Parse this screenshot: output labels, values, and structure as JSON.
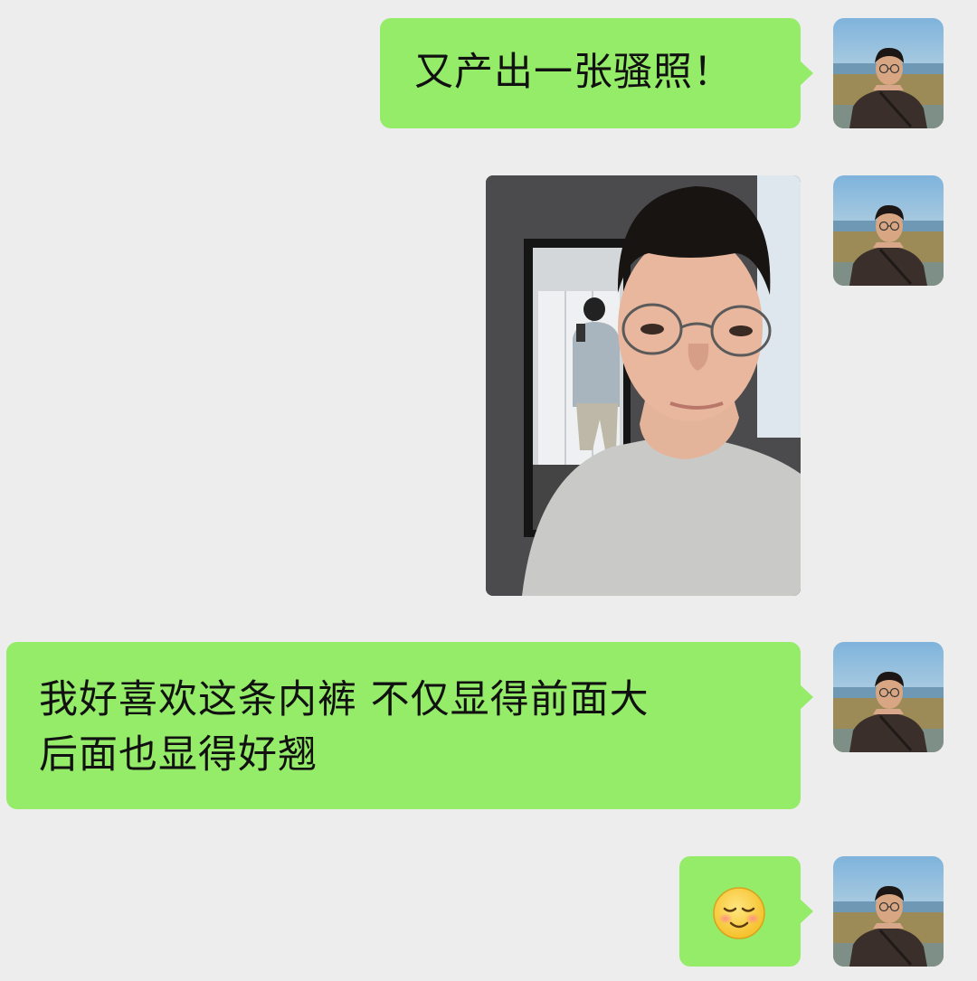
{
  "chat": {
    "messages": [
      {
        "type": "text",
        "sender": "me",
        "text": "又产出一张骚照！"
      },
      {
        "type": "image",
        "sender": "me"
      },
      {
        "type": "text",
        "sender": "me",
        "text": "我好喜欢这条内裤 不仅显得前面大\n后面也显得好翘"
      },
      {
        "type": "emoji",
        "sender": "me",
        "emoji": "blushing-smile-emoji"
      }
    ]
  },
  "theme": {
    "background": "#ededed",
    "bubble_color": "#95ec69",
    "text_color": "#111111"
  }
}
